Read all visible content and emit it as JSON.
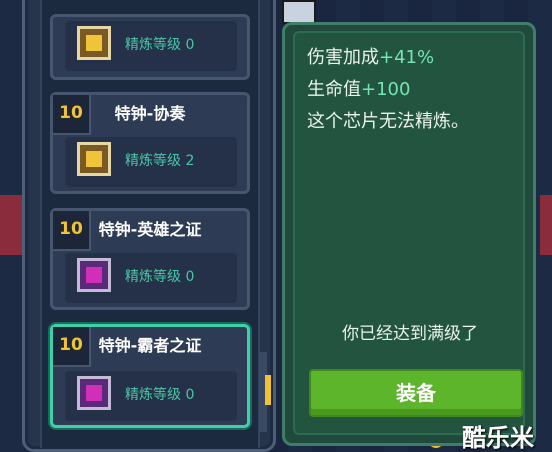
{
  "chip_list": {
    "items": [
      {
        "name": "",
        "level_badge": "",
        "refine_label": "精炼等级 0",
        "icon": "gold-chip-icon",
        "selected": false
      },
      {
        "name": "特钟-协奏",
        "level_badge": "10",
        "refine_label": "精炼等级 2",
        "icon": "gold-chip-icon",
        "selected": false
      },
      {
        "name": "特钟-英雄之证",
        "level_badge": "10",
        "refine_label": "精炼等级 0",
        "icon": "purple-chip-icon",
        "selected": false
      },
      {
        "name": "特钟-霸者之证",
        "level_badge": "10",
        "refine_label": "精炼等级 0",
        "icon": "purple-chip-icon",
        "selected": true
      }
    ]
  },
  "detail": {
    "damage_label": "伤害加成",
    "damage_value": "+41%",
    "hp_label": "生命值",
    "hp_value": "+100",
    "no_refine_text": "这个芯片无法精炼。",
    "maxed_text": "你已经达到满级了",
    "equip_button": "装备"
  },
  "watermark": "酷乐米",
  "colors": {
    "stat_value": "#74e6b2",
    "badge": "#f2c230",
    "refine_text": "#49c6a5",
    "equip_button": "#5cb52a",
    "selected_border": "#3fd0a7"
  }
}
